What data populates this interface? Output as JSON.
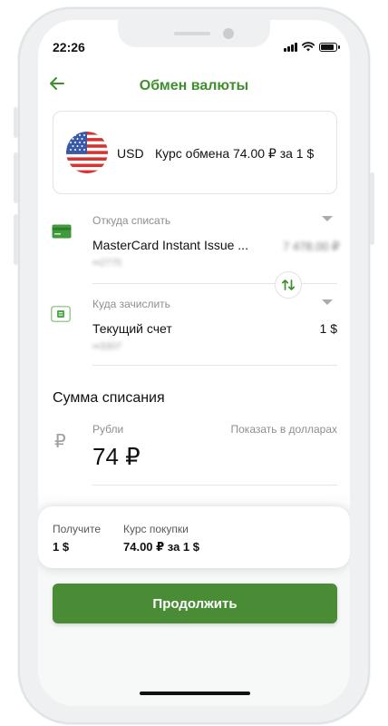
{
  "status_bar": {
    "time": "22:26"
  },
  "header": {
    "title": "Обмен валюты"
  },
  "rate_card": {
    "currency": "USD",
    "rate_text": "Курс обмена 74.00 ₽ за 1 $"
  },
  "from_account": {
    "label": "Откуда списать",
    "name": "MasterCard Instant Issue ...",
    "balance_masked": "7 478.00 ₽",
    "number_masked": "••2775"
  },
  "to_account": {
    "label": "Куда зачислить",
    "name": "Текущий счет",
    "balance": "1 $",
    "number_masked": "••3307"
  },
  "amount_section": {
    "title": "Сумма списания",
    "currency_label": "Рубли",
    "toggle_label": "Показать в долларах",
    "currency_symbol": "₽",
    "amount": "74 ₽"
  },
  "summary": {
    "receive_label": "Получите",
    "receive_value": "1 $",
    "rate_label": "Курс покупки",
    "rate_value": "74.00 ₽ за 1 $"
  },
  "actions": {
    "continue_label": "Продолжить"
  },
  "colors": {
    "accent": "#3f8f2c",
    "button": "#4a8c36",
    "card_icon": "#3f9a3a"
  }
}
